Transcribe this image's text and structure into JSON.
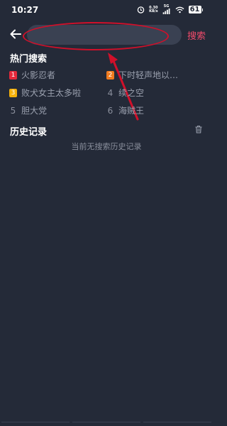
{
  "status_bar": {
    "time": "10:27",
    "speed_value": "0.30",
    "speed_unit": "KB/s",
    "network": "5G",
    "battery": "61",
    "icons": [
      "alarm-icon",
      "signal-icon",
      "wifi-icon",
      "battery-icon"
    ]
  },
  "search": {
    "placeholder": "",
    "button_label": "搜索"
  },
  "hot_search": {
    "title": "热门搜索",
    "items": [
      {
        "rank": "1",
        "label": "火影忍者",
        "color": "#e5293b"
      },
      {
        "rank": "2",
        "label": "下时轻声地以…",
        "color": "#f07b1f"
      },
      {
        "rank": "3",
        "label": "败犬女主太多啦",
        "color": "#f5b10a"
      },
      {
        "rank": "4",
        "label": "续之空",
        "color": ""
      },
      {
        "rank": "5",
        "label": "胆大党",
        "color": ""
      },
      {
        "rank": "6",
        "label": "海贼王",
        "color": ""
      }
    ]
  },
  "history": {
    "title": "历史记录",
    "empty_text": "当前无搜索历史记录"
  },
  "colors": {
    "background": "#242a38",
    "search_box": "#3a4152",
    "accent": "#f04a6a",
    "annotation": "#d0102a"
  }
}
